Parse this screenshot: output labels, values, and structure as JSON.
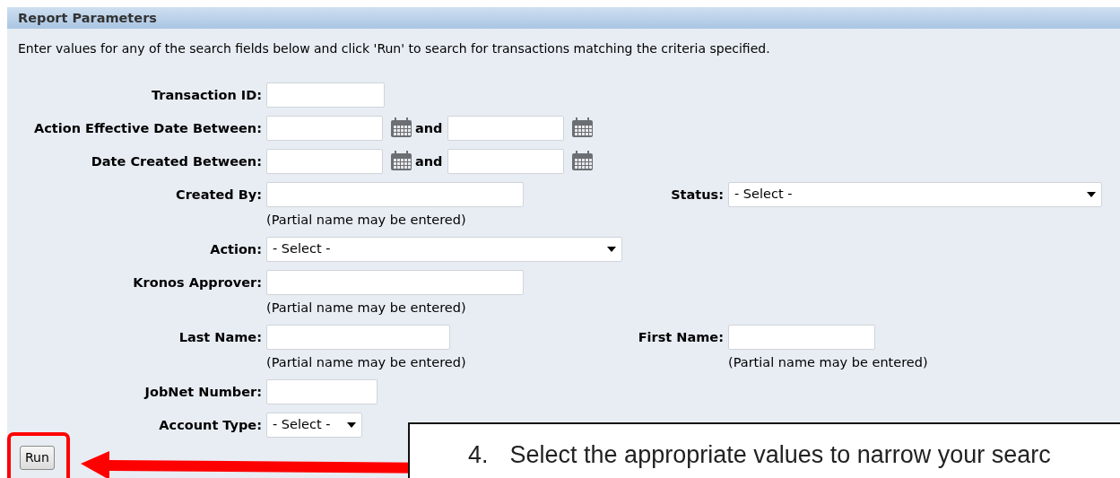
{
  "panel": {
    "title": "Report Parameters",
    "instructions": "Enter values for any of the search fields below and click 'Run' to search for transactions matching the criteria specified."
  },
  "rows": [
    {
      "left": {
        "label": "Transaction ID:",
        "kind": "text"
      }
    },
    {
      "left": {
        "label": "Action Effective Date Between:",
        "kind": "date_range",
        "connector": "and"
      }
    },
    {
      "left": {
        "label": "Date Created Between:",
        "kind": "date_range",
        "connector": "and"
      }
    },
    {
      "left": {
        "label": "Created By:",
        "kind": "text",
        "hint": "(Partial name may be entered)"
      },
      "right": {
        "label": "Status:",
        "kind": "select",
        "value": "- Select -"
      }
    },
    {
      "left": {
        "label": "Action:",
        "kind": "select",
        "value": "- Select -"
      }
    },
    {
      "left": {
        "label": "Kronos Approver:",
        "kind": "text",
        "hint": "(Partial name may be entered)"
      }
    },
    {
      "left": {
        "label": "Last Name:",
        "kind": "text",
        "hint": "(Partial name may be entered)"
      },
      "right": {
        "label": "First Name:",
        "kind": "text",
        "hint": "(Partial name may be entered)"
      }
    },
    {
      "left": {
        "label": "JobNet Number:",
        "kind": "text"
      }
    },
    {
      "left": {
        "label": "Account Type:",
        "kind": "select",
        "value": "- Select -"
      }
    }
  ],
  "run_button": {
    "label": "Run",
    "highlighted": true
  },
  "callout": {
    "number": "4.",
    "text": "Select the appropriate values to narrow your searc"
  }
}
